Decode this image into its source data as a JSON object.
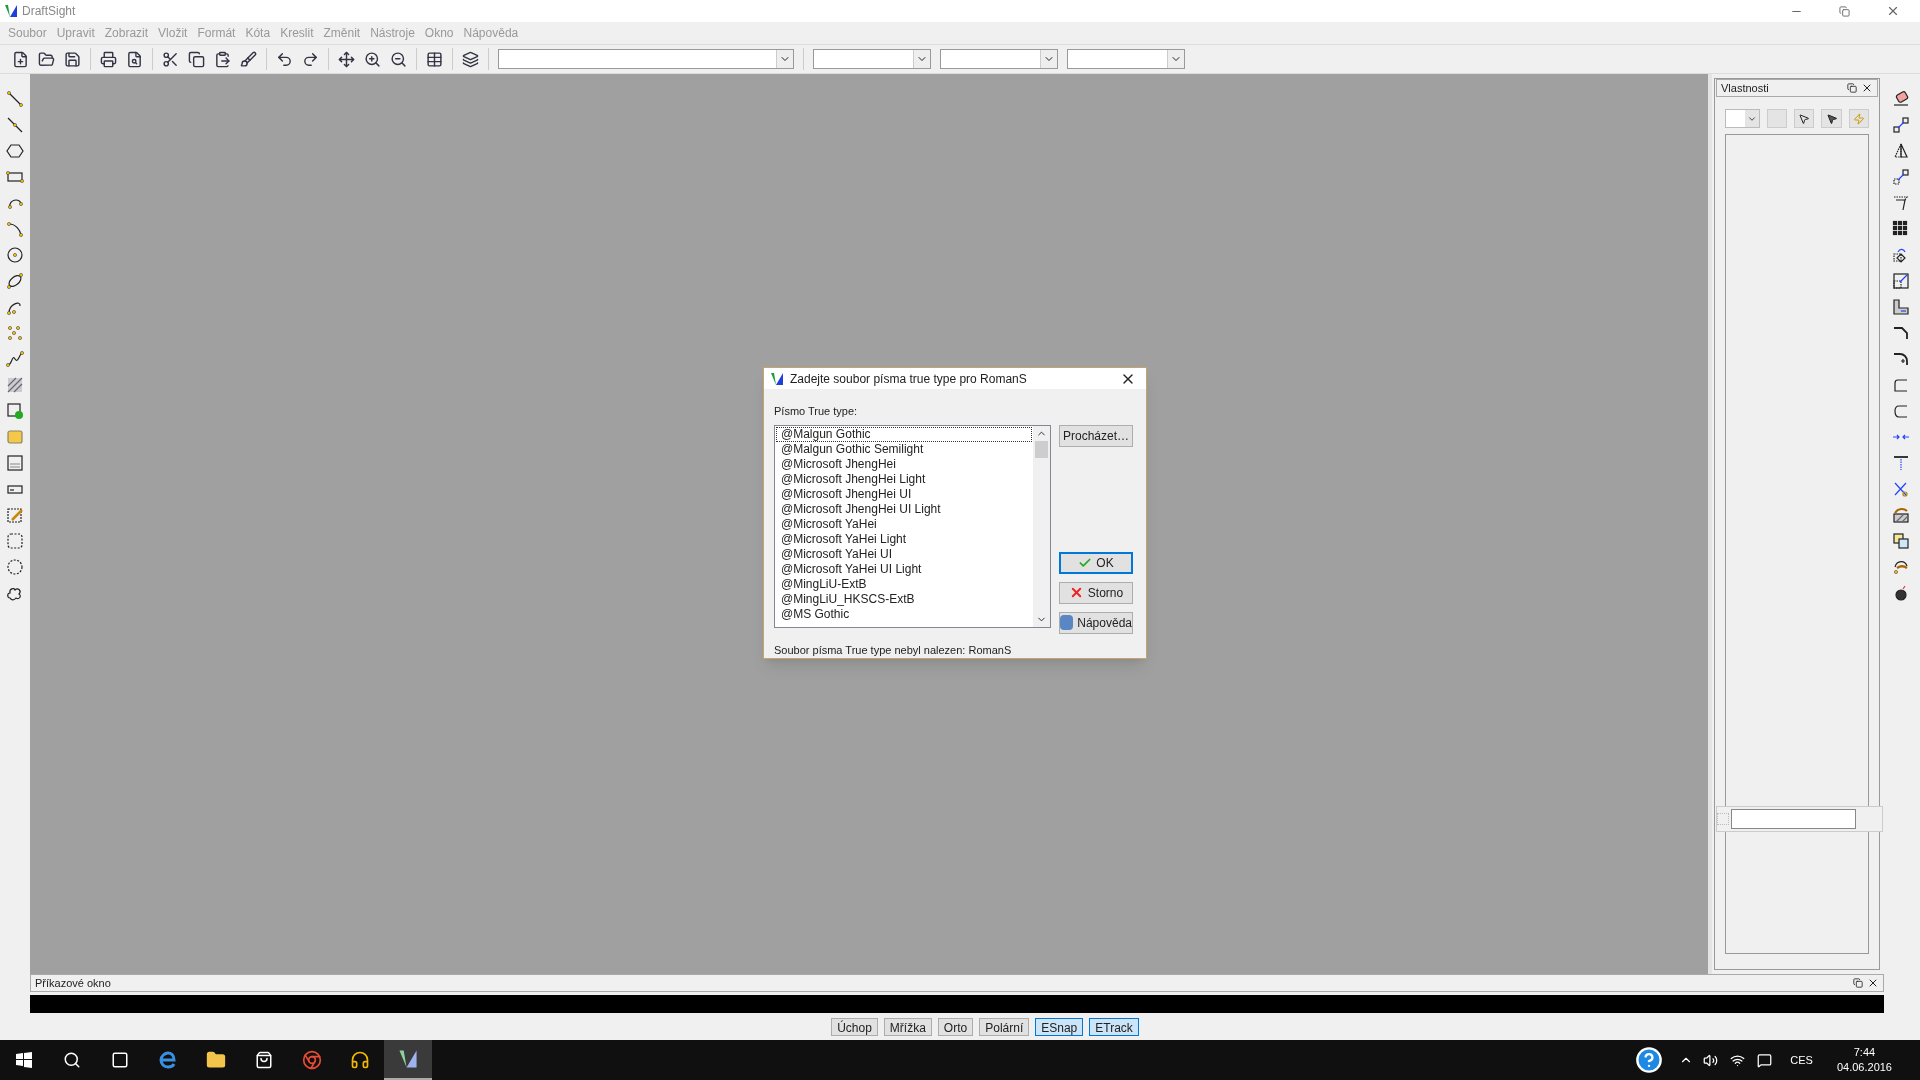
{
  "window": {
    "title": "DraftSight"
  },
  "menu": [
    "Soubor",
    "Upravit",
    "Zobrazit",
    "Vložit",
    "Formát",
    "Kóta",
    "Kreslit",
    "Změnit",
    "Nástroje",
    "Okno",
    "Nápověda"
  ],
  "dialog": {
    "title": "Zadejte soubor písma true type pro RomanS",
    "list_label": "Písmo True type:",
    "fonts": [
      {
        "name": "@Malgun Gothic",
        "selected": true
      },
      {
        "name": "@Malgun Gothic Semilight",
        "selected": false
      },
      {
        "name": "@Microsoft JhengHei",
        "selected": false
      },
      {
        "name": "@Microsoft JhengHei Light",
        "selected": false
      },
      {
        "name": "@Microsoft JhengHei UI",
        "selected": false
      },
      {
        "name": "@Microsoft JhengHei UI Light",
        "selected": false
      },
      {
        "name": "@Microsoft YaHei",
        "selected": false
      },
      {
        "name": "@Microsoft YaHei Light",
        "selected": false
      },
      {
        "name": "@Microsoft YaHei UI",
        "selected": false
      },
      {
        "name": "@Microsoft YaHei UI Light",
        "selected": false
      },
      {
        "name": "@MingLiU-ExtB",
        "selected": false
      },
      {
        "name": "@MingLiU_HKSCS-ExtB",
        "selected": false
      },
      {
        "name": "@MS Gothic",
        "selected": false
      }
    ],
    "buttons": [
      {
        "label": "Procházet…",
        "kind": "browse",
        "default": false
      },
      {
        "label": "OK",
        "kind": "ok",
        "default": true
      },
      {
        "label": "Storno",
        "kind": "cancel",
        "default": false
      },
      {
        "label": "Nápověda",
        "kind": "help",
        "default": false
      }
    ],
    "message": "Soubor písma True type nebyl nalezen: RomanS"
  },
  "properties_panel": {
    "title": "Vlastnosti"
  },
  "command_window": {
    "title": "Příkazové okno"
  },
  "status_toggles": [
    {
      "label": "Úchop",
      "on": false
    },
    {
      "label": "Mřížka",
      "on": false
    },
    {
      "label": "Orto",
      "on": false
    },
    {
      "label": "Polární",
      "on": false
    },
    {
      "label": "ESnap",
      "on": true
    },
    {
      "label": "ETrack",
      "on": true
    }
  ],
  "taskbar": {
    "language": "CES",
    "time": "7:44",
    "date": "04.06.2016"
  }
}
